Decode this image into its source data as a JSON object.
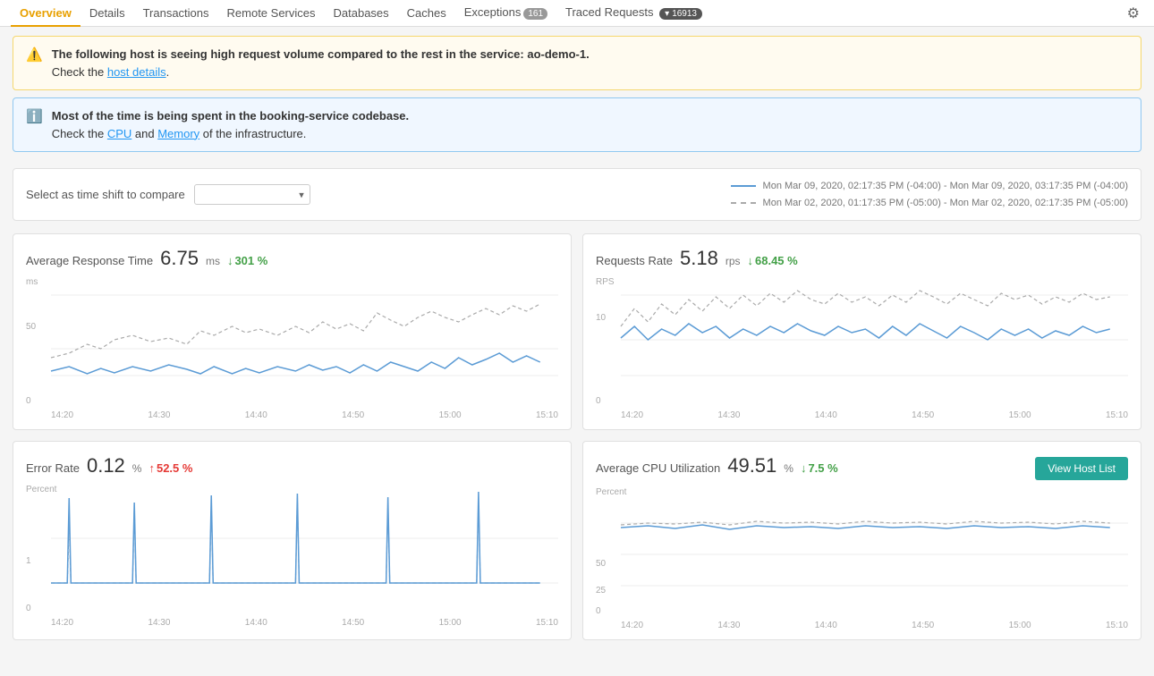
{
  "nav": {
    "items": [
      {
        "id": "overview",
        "label": "Overview",
        "active": true,
        "badge": null
      },
      {
        "id": "details",
        "label": "Details",
        "active": false,
        "badge": null
      },
      {
        "id": "transactions",
        "label": "Transactions",
        "active": false,
        "badge": null
      },
      {
        "id": "remote-services",
        "label": "Remote Services",
        "active": false,
        "badge": null
      },
      {
        "id": "databases",
        "label": "Databases",
        "active": false,
        "badge": null
      },
      {
        "id": "caches",
        "label": "Caches",
        "active": false,
        "badge": null
      },
      {
        "id": "exceptions",
        "label": "Exceptions",
        "active": false,
        "badge": "161"
      },
      {
        "id": "traced-requests",
        "label": "Traced Requests",
        "active": false,
        "badge": "16913"
      }
    ]
  },
  "alerts": [
    {
      "type": "warning",
      "icon": "⚠",
      "boldText": "The following host is seeing high request volume compared to the rest in the service: ao-demo-1.",
      "normalText": "Check the ",
      "linkText": "host details",
      "linkAfter": "."
    },
    {
      "type": "info",
      "icon": "ℹ",
      "boldText": "Most of the time is being spent in the booking-service codebase.",
      "line2pre": "Check the ",
      "link1": "CPU",
      "mid": " and ",
      "link2": "Memory",
      "line2post": " of the infrastructure."
    }
  ],
  "timeshift": {
    "label": "Select as time shift to compare",
    "placeholder": "",
    "legend": [
      {
        "type": "solid",
        "text": "Mon Mar 09, 2020, 02:17:35 PM (-04:00) - Mon Mar 09, 2020, 03:17:35 PM (-04:00)"
      },
      {
        "type": "dashed",
        "text": "Mon Mar 02, 2020, 01:17:35 PM (-05:00) - Mon Mar 02, 2020, 02:17:35 PM (-05:00)"
      }
    ]
  },
  "charts": [
    {
      "id": "avg-response-time",
      "title": "Average Response Time",
      "value": "6.75",
      "unit": "ms",
      "changeDir": "down",
      "changeVal": "301 %",
      "yLabel": "ms",
      "yTick": "50",
      "xTicks": [
        "14:20",
        "14:30",
        "14:40",
        "14:50",
        "15:00",
        "15:10"
      ],
      "hasHostBtn": false
    },
    {
      "id": "requests-rate",
      "title": "Requests Rate",
      "value": "5.18",
      "unit": "rps",
      "changeDir": "down",
      "changeVal": "68.45 %",
      "yLabel": "RPS",
      "yTick": "10",
      "xTicks": [
        "14:20",
        "14:30",
        "14:40",
        "14:50",
        "15:00",
        "15:10"
      ],
      "hasHostBtn": false
    },
    {
      "id": "error-rate",
      "title": "Error Rate",
      "value": "0.12",
      "unit": "%",
      "changeDir": "up",
      "changeVal": "52.5 %",
      "yLabel": "Percent",
      "yTick": "1",
      "xTicks": [
        "14:20",
        "14:30",
        "14:40",
        "14:50",
        "15:00",
        "15:10"
      ],
      "hasHostBtn": false
    },
    {
      "id": "avg-cpu",
      "title": "Average CPU Utilization",
      "value": "49.51",
      "unit": "%",
      "changeDir": "down",
      "changeVal": "7.5 %",
      "yLabel": "Percent",
      "yTick1": "50",
      "yTick2": "25",
      "xTicks": [
        "14:20",
        "14:30",
        "14:40",
        "14:50",
        "15:00",
        "15:10"
      ],
      "hasHostBtn": true,
      "hostBtnLabel": "View Host List"
    }
  ],
  "gear": {
    "title": "Settings"
  }
}
